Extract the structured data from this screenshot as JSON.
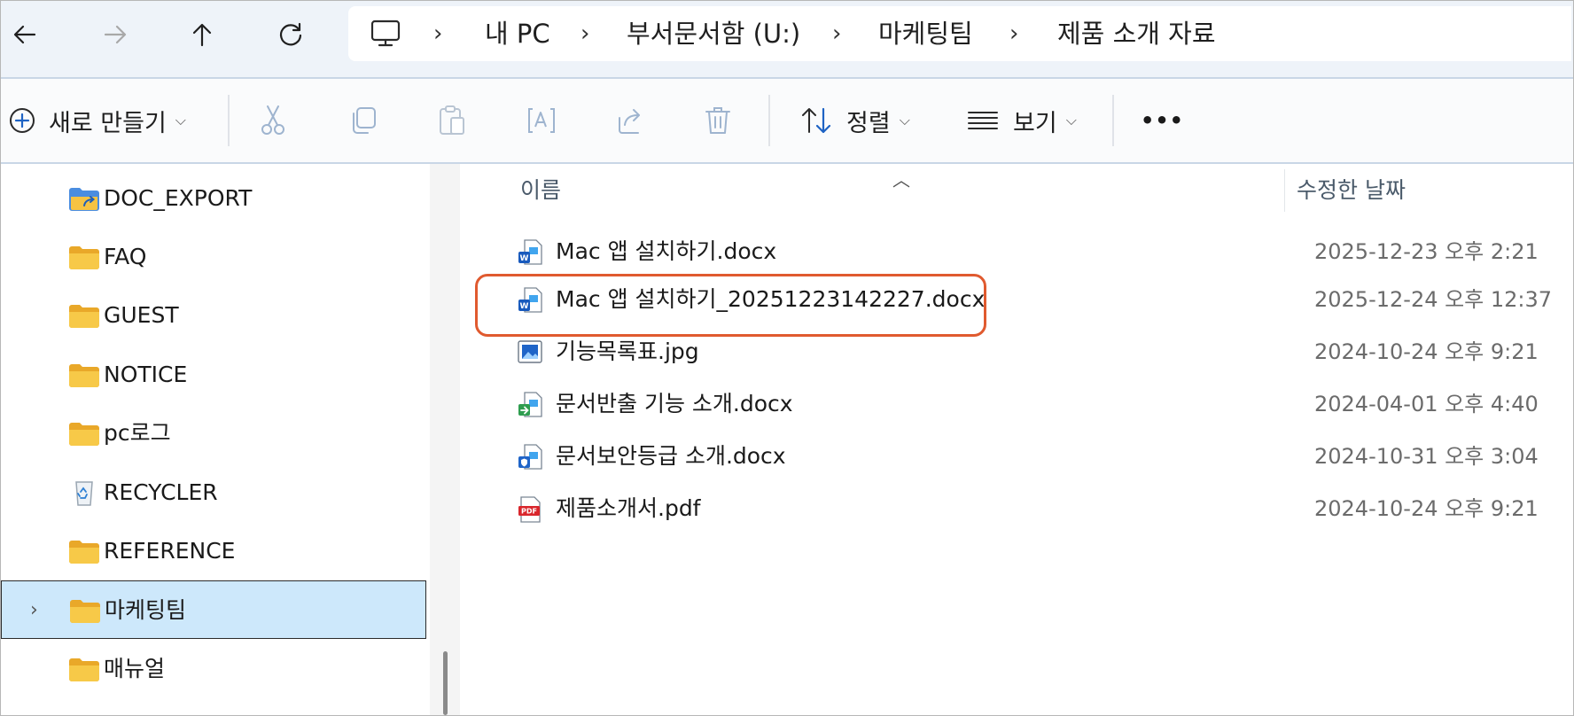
{
  "nav": {
    "back_icon": "back-arrow-icon",
    "forward_icon": "forward-arrow-icon",
    "up_icon": "up-arrow-icon",
    "refresh_icon": "refresh-icon"
  },
  "breadcrumb": {
    "pc_icon": "monitor-icon",
    "items": [
      "내 PC",
      "부서문서함 (U:)",
      "마케팅팀",
      "제품 소개 자료"
    ]
  },
  "toolbar": {
    "new_label": "새로 만들기",
    "sort_label": "정렬",
    "view_label": "보기",
    "more_label": "•••"
  },
  "sidebar": {
    "items": [
      {
        "label": "DOC_EXPORT",
        "icon": "shared-folder-icon"
      },
      {
        "label": "FAQ",
        "icon": "folder-icon"
      },
      {
        "label": "GUEST",
        "icon": "folder-icon"
      },
      {
        "label": "NOTICE",
        "icon": "folder-icon"
      },
      {
        "label": "pc로그",
        "icon": "folder-icon"
      },
      {
        "label": "RECYCLER",
        "icon": "recycle-bin-icon"
      },
      {
        "label": "REFERENCE",
        "icon": "folder-icon"
      },
      {
        "label": "마케팅팀",
        "icon": "folder-icon",
        "selected": true
      },
      {
        "label": "매뉴얼",
        "icon": "folder-icon"
      }
    ]
  },
  "columns": {
    "name": "이름",
    "modified": "수정한 날짜"
  },
  "files": [
    {
      "name": "Mac 앱 설치하기.docx",
      "modified": "2025-12-23 오후 2:21",
      "icon": "word-doc-icon"
    },
    {
      "name": "Mac 앱 설치하기_20251223142227.docx",
      "modified": "2025-12-24 오후 12:37",
      "icon": "word-doc-icon"
    },
    {
      "name": "기능목록표.jpg",
      "modified": "2024-10-24 오후 9:21",
      "icon": "image-file-icon"
    },
    {
      "name": "문서반출 기능 소개.docx",
      "modified": "2024-04-01 오후 4:40",
      "icon": "word-doc-export-icon"
    },
    {
      "name": "문서보안등급 소개.docx",
      "modified": "2024-10-31 오후 3:04",
      "icon": "word-doc-secure-icon"
    },
    {
      "name": "제품소개서.pdf",
      "modified": "2024-10-24 오후 9:21",
      "icon": "pdf-file-icon"
    }
  ],
  "colors": {
    "accent_highlight": "#e05a2f",
    "selection_bg": "#cde8fb",
    "folder_yellow": "#f6c342",
    "word_blue": "#185abd"
  }
}
